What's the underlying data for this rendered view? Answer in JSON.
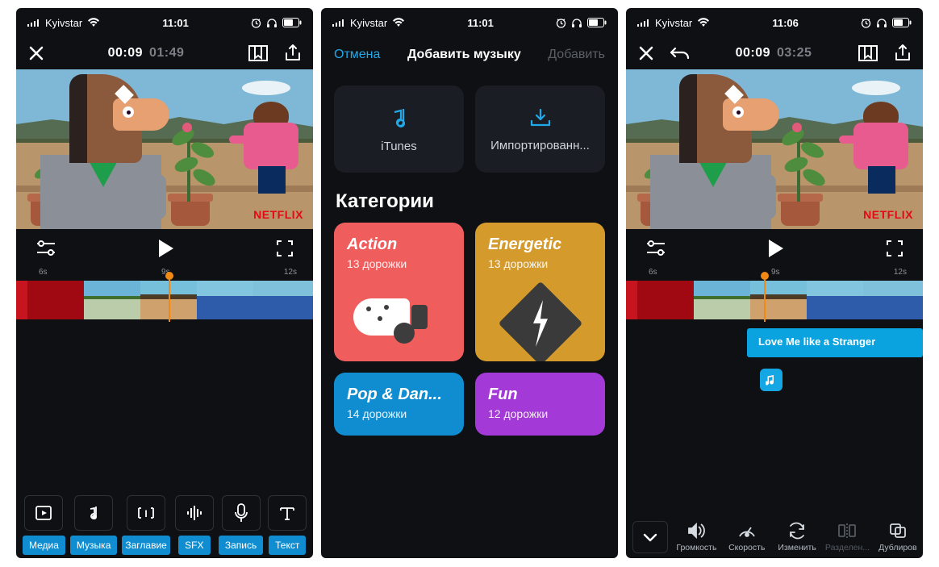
{
  "screen1": {
    "status": {
      "carrier": "Kyivstar",
      "time": "11:01"
    },
    "top": {
      "current": "00:09",
      "total": "01:49"
    },
    "netflix": "NETFLIX",
    "ruler": [
      "6s",
      "9s",
      "12s"
    ],
    "tools": [
      {
        "label": "Медиа"
      },
      {
        "label": "Музыка"
      },
      {
        "label": "Заглавие"
      },
      {
        "label": "SFX"
      },
      {
        "label": "Запись"
      },
      {
        "label": "Текст"
      }
    ]
  },
  "screen2": {
    "status": {
      "carrier": "Kyivstar",
      "time": "11:01"
    },
    "nav": {
      "cancel": "Отмена",
      "title": "Добавить музыку",
      "add": "Добавить"
    },
    "imports": [
      {
        "label": "iTunes"
      },
      {
        "label": "Импортированн..."
      }
    ],
    "section": "Категории",
    "cats": [
      {
        "title": "Action",
        "sub": "13 дорожки",
        "color": "c-red"
      },
      {
        "title": "Energetic",
        "sub": "13 дорожки",
        "color": "c-gold"
      },
      {
        "title": "Pop & Dan...",
        "sub": "14 дорожки",
        "color": "c-blue"
      },
      {
        "title": "Fun",
        "sub": "12 дорожки",
        "color": "c-purp"
      }
    ]
  },
  "screen3": {
    "status": {
      "carrier": "Kyivstar",
      "time": "11:06"
    },
    "top": {
      "current": "00:09",
      "total": "03:25"
    },
    "netflix": "NETFLIX",
    "ruler": [
      "6s",
      "9s",
      "12s"
    ],
    "audio_clip": "Love Me like a Stranger",
    "tools": [
      {
        "label": "Громкость"
      },
      {
        "label": "Скорость"
      },
      {
        "label": "Изменить"
      },
      {
        "label": "Разделен..."
      },
      {
        "label": "Дублиров"
      }
    ]
  }
}
